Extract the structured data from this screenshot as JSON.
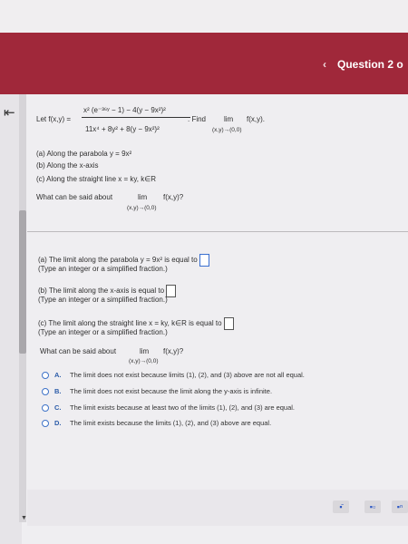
{
  "header": {
    "question_label": "Question 2 o"
  },
  "problem": {
    "let_label": "Let f(x,y) =",
    "numerator": "x² (e⁻³⁶ʸ − 1) − 4(y − 9x²)²",
    "denominator": "11x⁴ + 8y² + 8(y − 9x²)²",
    "find_label": ". Find",
    "lim": "lim",
    "lim_sub": "(x,y)→(0,0)",
    "fxy": "f(x,y).",
    "parts": [
      "(a) Along the parabola y = 9x²",
      "(b) Along the x-axis",
      "(c) Along the straight line x = ky, k∈R"
    ],
    "what_label": "What can be said about",
    "what_fxy": "f(x,y)?"
  },
  "answers": {
    "a_line": "(a) The limit along the parabola y = 9x² is equal to",
    "a_hint": "(Type an integer or a simplified fraction.)",
    "b_line": "(b) The limit along the x-axis is equal to",
    "b_hint": "(Type an integer or a simplified fraction.)",
    "c_line": "(c) The limit along the straight line x = ky, k∈R is equal to",
    "c_hint": "(Type an integer or a simplified fraction.)",
    "what_label": "What can be said about",
    "lim": "lim",
    "lim_sub": "(x,y)→(0,0)",
    "what_fxy": "f(x,y)?"
  },
  "options": [
    {
      "letter": "A.",
      "text": "The limit does not exist because limits (1), (2), and (3) above are not all equal."
    },
    {
      "letter": "B.",
      "text": "The limit does not exist because the limit along the y-axis is infinite."
    },
    {
      "letter": "C.",
      "text": "The limit exists because at least two of the limits (1), (2), and (3) are equal."
    },
    {
      "letter": "D.",
      "text": "The limit exists because the limits (1), (2), and (3) above are equal."
    }
  ],
  "icons": {
    "collapse": "collapse-arrow-icon",
    "chevron": "chevron-left-icon",
    "tools": [
      "fraction-icon",
      "mixed-number-icon",
      "exponent-icon"
    ]
  },
  "colors": {
    "brand_red": "#a0283a",
    "radio_blue": "#3e72c8"
  }
}
